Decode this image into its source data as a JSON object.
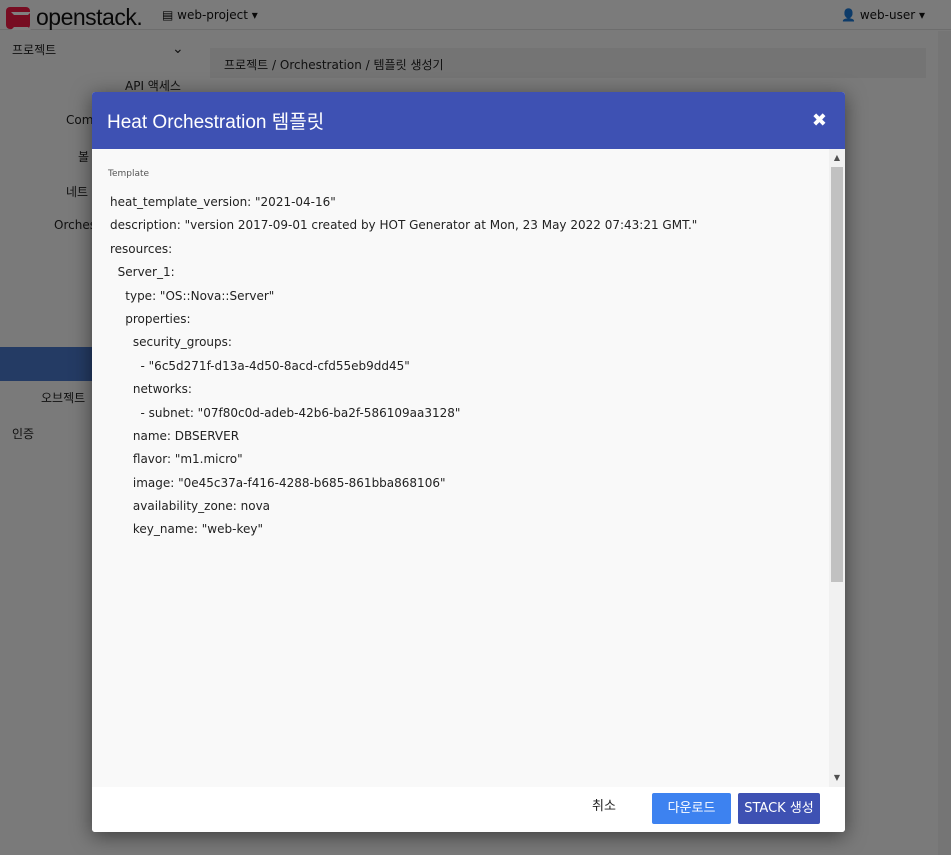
{
  "topbar": {
    "logo_text": "openstack.",
    "project_label": "▤ web-project ▾",
    "user_label": "👤 web-user ▾"
  },
  "sidebar": {
    "items": [
      {
        "label": "프로젝트"
      },
      {
        "label": "API 액세스"
      },
      {
        "label": "Comp"
      },
      {
        "label": "볼"
      },
      {
        "label": "네트"
      },
      {
        "label": "Orches"
      },
      {
        "label": "오브젝트"
      },
      {
        "label": "인증"
      }
    ]
  },
  "breadcrumb": {
    "items": [
      "프로젝트",
      "Orchestration",
      "템플릿 생성기"
    ],
    "separator": "/"
  },
  "modal": {
    "title": "Heat Orchestration 템플릿",
    "close_glyph": "✖",
    "template_label": "Template",
    "code_lines": [
      "heat_template_version: \"2021-04-16\"",
      "description: \"version 2017-09-01 created by HOT Generator at Mon, 23 May 2022 07:43:21 GMT.\"",
      "resources:",
      "  Server_1:",
      "    type: \"OS::Nova::Server\"",
      "    properties:",
      "      security_groups:",
      "        - \"6c5d271f-d13a-4d50-8acd-cfd55eb9dd45\"",
      "      networks:",
      "        - subnet: \"07f80c0d-adeb-42b6-ba2f-586109aa3128\"",
      "      name: DBSERVER",
      "      flavor: \"m1.micro\"",
      "      image: \"0e45c37a-f416-4288-b685-861bba868106\"",
      "      availability_zone: nova",
      "      key_name: \"web-key\""
    ],
    "footer": {
      "cancel_label": "취소",
      "download_label": "다운로드",
      "create_label": "STACK 생성"
    }
  },
  "colors": {
    "header_bg": "#3e51b3",
    "download_bg": "#3d82f0",
    "create_bg": "#3e51b3",
    "brand_red": "#ed1944"
  }
}
